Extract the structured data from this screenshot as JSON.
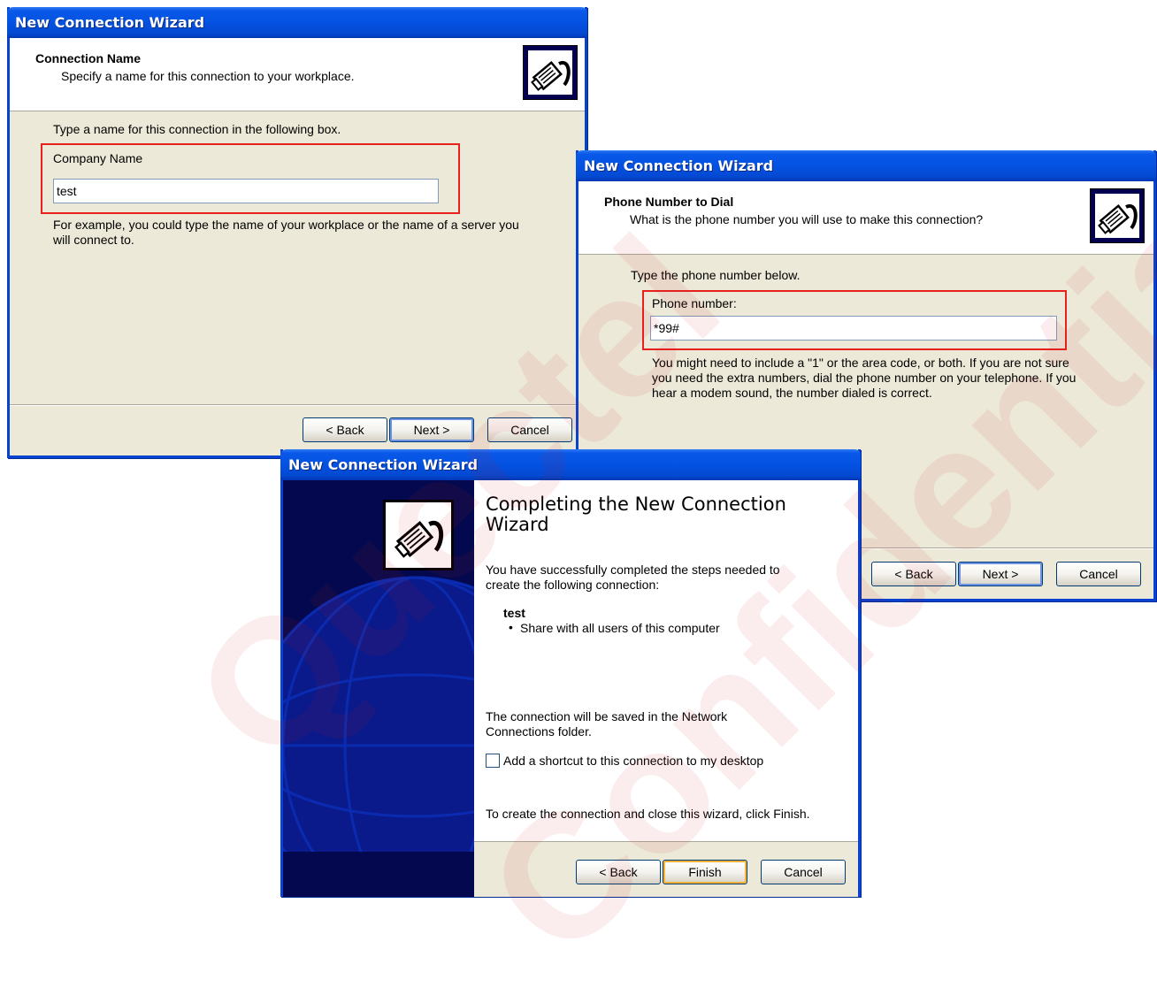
{
  "watermark": {
    "line1": "Quectel",
    "line2": "Confidential"
  },
  "win1": {
    "title": "New Connection Wizard",
    "header_title": "Connection Name",
    "header_sub": "Specify a name for this connection to your workplace.",
    "instruction": "Type a name for this connection in the following box.",
    "field_label": "Company Name",
    "field_value": "test",
    "example": "For example, you could type the name of your workplace or the name of a server you will connect to.",
    "back": "< Back",
    "next": "Next >",
    "cancel": "Cancel"
  },
  "win2": {
    "title": "New Connection Wizard",
    "header_title": "Phone Number to Dial",
    "header_sub": "What is the phone number you will use to make this connection?",
    "instruction": "Type the phone number below.",
    "field_label": "Phone number:",
    "field_value": "*99#",
    "hint": "You might need to include a \"1\" or the area code, or both. If you are not sure you need the extra numbers, dial the phone number on your telephone. If you hear a modem sound, the number dialed is correct.",
    "back": "< Back",
    "next": "Next >",
    "cancel": "Cancel"
  },
  "win3": {
    "title": "New Connection Wizard",
    "heading": "Completing the New Connection Wizard",
    "intro": "You have successfully completed the steps needed to create the following connection:",
    "conn_name": "test",
    "bullet": "Share with all users of this computer",
    "saved": "The connection will be saved in the Network Connections folder.",
    "shortcut_label": "Add a shortcut to this connection to my desktop",
    "shortcut_checked": false,
    "finish_note": "To create the connection and close this wizard, click Finish.",
    "back": "< Back",
    "finish": "Finish",
    "cancel": "Cancel"
  }
}
